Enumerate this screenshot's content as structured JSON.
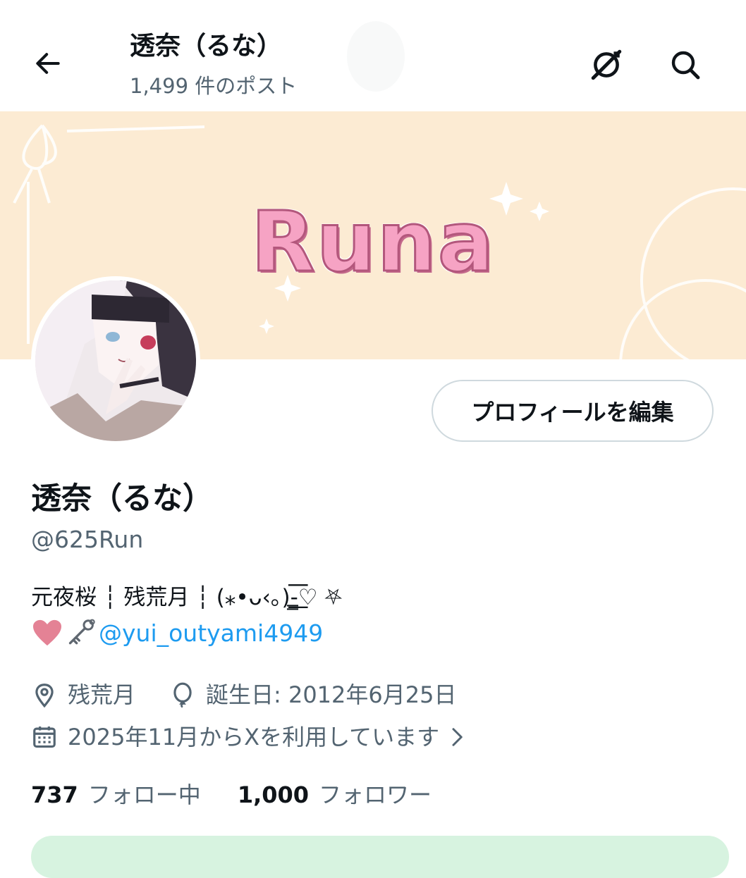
{
  "header": {
    "title": "透奈（るな）",
    "post_count": "1,499 件のポスト"
  },
  "banner": {
    "text": "Runa",
    "bg_color": "#fcebd3",
    "text_color": "#f6a3c4"
  },
  "profile": {
    "edit_button": "プロフィールを編集",
    "display_name": "透奈（るな）",
    "handle": "@625Run",
    "bio_line1": "元夜桜 ┆ 残荒月 ┆ (⁎•ᴗ‹｡)-̳͟͞͞♡ ⛧",
    "bio_mention": "@yui_outyami4949",
    "location": "残荒月",
    "birthday": "誕生日: 2012年6月25日",
    "joined": "2025年11月からXを利用しています"
  },
  "stats": {
    "following_count": "737",
    "following_label": "フォロー中",
    "followers_count": "1,000",
    "followers_label": "フォロワー"
  },
  "colors": {
    "accent": "#1d9bf0",
    "secondary_text": "#536471"
  }
}
